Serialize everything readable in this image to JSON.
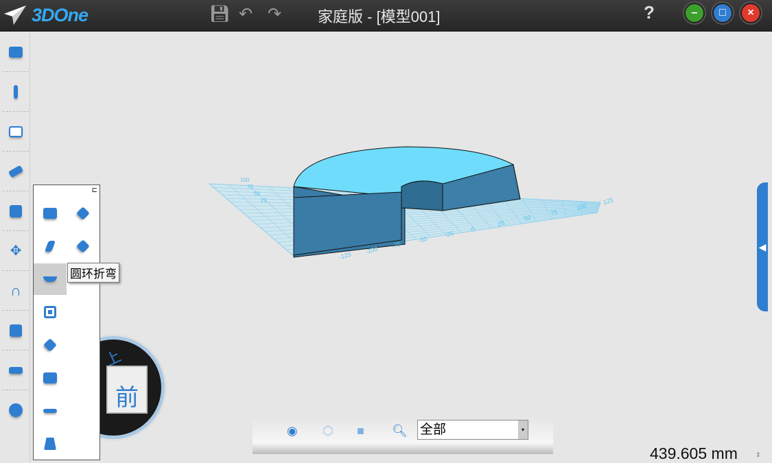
{
  "app": {
    "logo": "3DOne",
    "title": "家庭版 - [模型001]",
    "help": "?"
  },
  "titlebar_icons": [
    "save-icon",
    "undo-icon",
    "redo-icon"
  ],
  "window_buttons": {
    "minimize": "–",
    "maximize": "□",
    "close": "×"
  },
  "left_toolbar": [
    "primitives",
    "sketch",
    "sketch-edit",
    "feature",
    "special-feature",
    "move",
    "pattern",
    "combine",
    "measure",
    "material"
  ],
  "flyout": {
    "items": [
      "shell",
      "wrap",
      "twist",
      "bend",
      "torus-bend",
      "embed",
      "peel",
      "split",
      "draft",
      "taper"
    ],
    "tooltip": "圆环折弯"
  },
  "viewcube": {
    "front": "前",
    "top": "上"
  },
  "grid_labels": {
    "x": [
      "-125",
      "-100",
      "-75",
      "-50",
      "-25",
      "0",
      "25",
      "50",
      "75",
      "100",
      "125"
    ],
    "y": [
      "100",
      "75",
      "50",
      "25"
    ]
  },
  "bottom": {
    "filter_value": "全部"
  },
  "scale": "439.605 mm",
  "colors": {
    "accent": "#2f7ed0",
    "model_top": "#6fdcfb",
    "model_side": "#3a7ca6"
  }
}
